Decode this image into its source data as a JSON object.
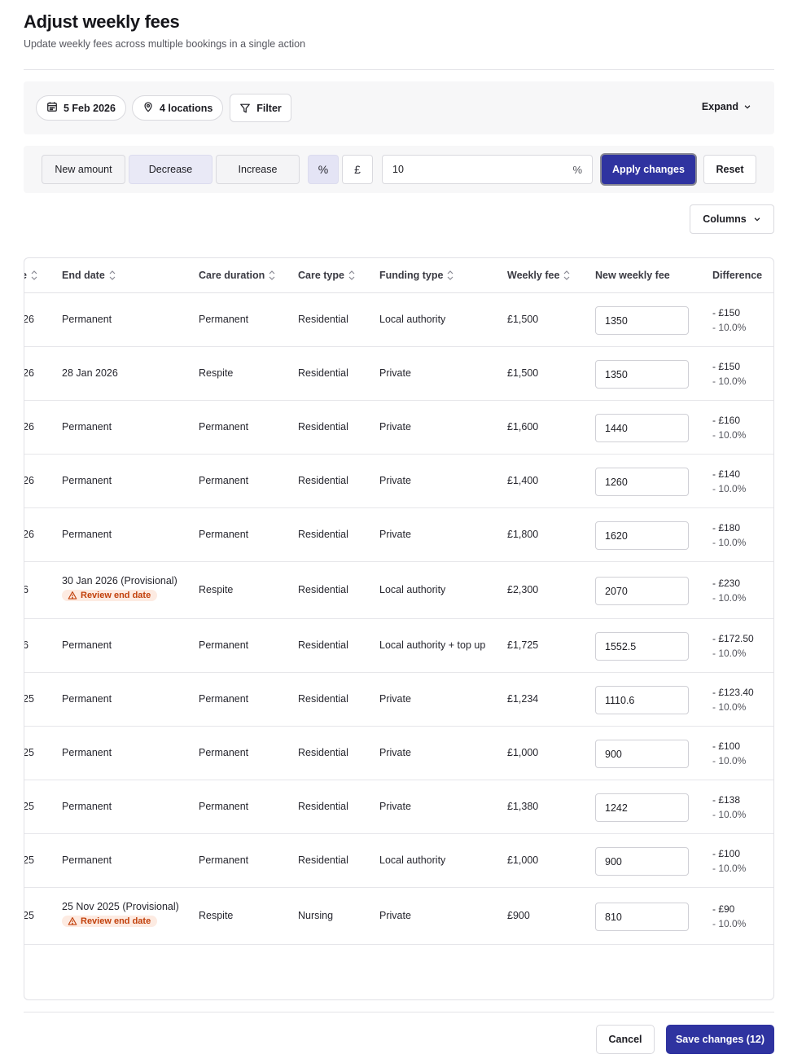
{
  "header": {
    "title": "Adjust weekly fees",
    "subtitle": "Update weekly fees across multiple bookings in a single action"
  },
  "filters": {
    "date": "5 Feb 2026",
    "locations": "4 locations",
    "filter_label": "Filter",
    "expand_label": "Expand"
  },
  "adjust": {
    "modes": [
      "New amount",
      "Decrease",
      "Increase"
    ],
    "active_mode": "Decrease",
    "unit_percent": "%",
    "unit_pound": "£",
    "active_unit": "%",
    "amount_value": "10",
    "amount_suffix": "%",
    "apply_label": "Apply changes",
    "reset_label": "Reset"
  },
  "columns_label": "Columns",
  "table": {
    "headers": {
      "partial": "e",
      "end_date": "End date",
      "care_duration": "Care duration",
      "care_type": "Care type",
      "funding_type": "Funding type",
      "weekly_fee": "Weekly fee",
      "new_weekly_fee": "New weekly fee",
      "difference": "Difference"
    },
    "review_badge": "Review end date",
    "rows": [
      {
        "partial": "26",
        "end_date": "Permanent",
        "review": false,
        "care_duration": "Permanent",
        "care_type": "Residential",
        "funding_type": "Local authority",
        "weekly_fee": "£1,500",
        "new_fee": "1350",
        "diff_amount": "- £150",
        "diff_pct": "- 10.0%"
      },
      {
        "partial": "26",
        "end_date": "28 Jan 2026",
        "review": false,
        "care_duration": "Respite",
        "care_type": "Residential",
        "funding_type": "Private",
        "weekly_fee": "£1,500",
        "new_fee": "1350",
        "diff_amount": "- £150",
        "diff_pct": "- 10.0%"
      },
      {
        "partial": "26",
        "end_date": "Permanent",
        "review": false,
        "care_duration": "Permanent",
        "care_type": "Residential",
        "funding_type": "Private",
        "weekly_fee": "£1,600",
        "new_fee": "1440",
        "diff_amount": "- £160",
        "diff_pct": "- 10.0%"
      },
      {
        "partial": "26",
        "end_date": "Permanent",
        "review": false,
        "care_duration": "Permanent",
        "care_type": "Residential",
        "funding_type": "Private",
        "weekly_fee": "£1,400",
        "new_fee": "1260",
        "diff_amount": "- £140",
        "diff_pct": "- 10.0%"
      },
      {
        "partial": "26",
        "end_date": "Permanent",
        "review": false,
        "care_duration": "Permanent",
        "care_type": "Residential",
        "funding_type": "Private",
        "weekly_fee": "£1,800",
        "new_fee": "1620",
        "diff_amount": "- £180",
        "diff_pct": "- 10.0%"
      },
      {
        "partial": "6",
        "end_date": "30 Jan 2026 (Provisional)",
        "review": true,
        "care_duration": "Respite",
        "care_type": "Residential",
        "funding_type": "Local authority",
        "weekly_fee": "£2,300",
        "new_fee": "2070",
        "diff_amount": "- £230",
        "diff_pct": "- 10.0%"
      },
      {
        "partial": "6",
        "end_date": "Permanent",
        "review": false,
        "care_duration": "Permanent",
        "care_type": "Residential",
        "funding_type": "Local authority + top up",
        "weekly_fee": "£1,725",
        "new_fee": "1552.5",
        "diff_amount": "- £172.50",
        "diff_pct": "- 10.0%"
      },
      {
        "partial": "25",
        "end_date": "Permanent",
        "review": false,
        "care_duration": "Permanent",
        "care_type": "Residential",
        "funding_type": "Private",
        "weekly_fee": "£1,234",
        "new_fee": "1110.6",
        "diff_amount": "- £123.40",
        "diff_pct": "- 10.0%"
      },
      {
        "partial": "25",
        "end_date": "Permanent",
        "review": false,
        "care_duration": "Permanent",
        "care_type": "Residential",
        "funding_type": "Private",
        "weekly_fee": "£1,000",
        "new_fee": "900",
        "diff_amount": "- £100",
        "diff_pct": "- 10.0%"
      },
      {
        "partial": "25",
        "end_date": "Permanent",
        "review": false,
        "care_duration": "Permanent",
        "care_type": "Residential",
        "funding_type": "Private",
        "weekly_fee": "£1,380",
        "new_fee": "1242",
        "diff_amount": "- £138",
        "diff_pct": "- 10.0%"
      },
      {
        "partial": "25",
        "end_date": "Permanent",
        "review": false,
        "care_duration": "Permanent",
        "care_type": "Residential",
        "funding_type": "Local authority",
        "weekly_fee": "£1,000",
        "new_fee": "900",
        "diff_amount": "- £100",
        "diff_pct": "- 10.0%"
      },
      {
        "partial": "25",
        "end_date": "25 Nov 2025 (Provisional)",
        "review": true,
        "care_duration": "Respite",
        "care_type": "Nursing",
        "funding_type": "Private",
        "weekly_fee": "£900",
        "new_fee": "810",
        "diff_amount": "- £90",
        "diff_pct": "- 10.0%"
      }
    ]
  },
  "footer": {
    "cancel_label": "Cancel",
    "save_label": "Save changes (12)"
  },
  "colors": {
    "primary": "#2f33a0",
    "warning_bg": "#fdebe2",
    "warning_text": "#c2410c"
  }
}
